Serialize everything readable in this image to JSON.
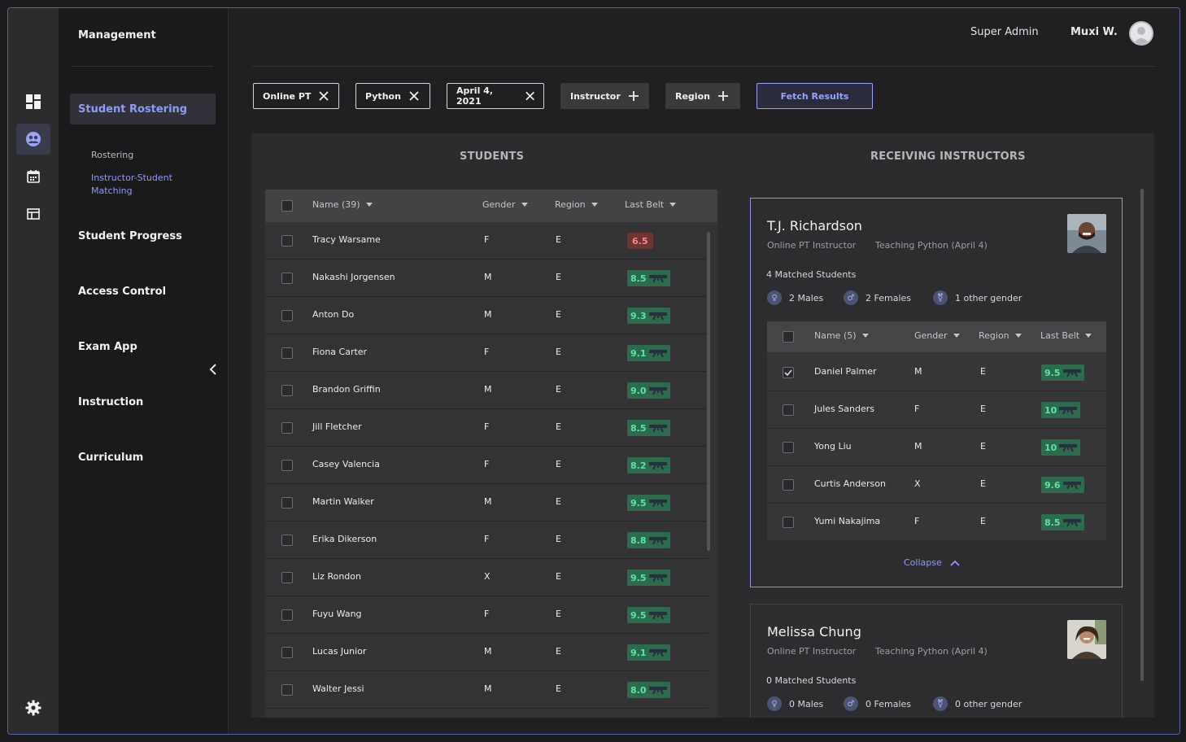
{
  "nav": {
    "title": "Management",
    "active_section": "Student Rostering",
    "sub_items": [
      "Rostering",
      "Instructor-Student Matching"
    ],
    "items": [
      "Student Progress",
      "Access Control",
      "Exam App",
      "Instruction",
      "Curriculum"
    ]
  },
  "header": {
    "role": "Super Admin",
    "user": "Muxi W."
  },
  "filters": {
    "chips": [
      "Online PT",
      "Python",
      "April 4, 2021"
    ],
    "add_chips": [
      "Instructor",
      "Region"
    ],
    "fetch_label": "Fetch Results"
  },
  "students": {
    "heading": "STUDENTS",
    "columns": [
      "Name (39)",
      "Gender",
      "Region",
      "Last Belt"
    ],
    "rows": [
      {
        "name": "Tracy Warsame",
        "gender": "F",
        "region": "E",
        "belt": "6.5",
        "status": "red"
      },
      {
        "name": "Nakashi Jorgensen",
        "gender": "M",
        "region": "E",
        "belt": "8.5",
        "status": "green"
      },
      {
        "name": "Anton Do",
        "gender": "M",
        "region": "E",
        "belt": "9.3",
        "status": "green"
      },
      {
        "name": "Fiona Carter",
        "gender": "F",
        "region": "E",
        "belt": "9.1",
        "status": "green"
      },
      {
        "name": "Brandon Griffin",
        "gender": "M",
        "region": "E",
        "belt": "9.0",
        "status": "green"
      },
      {
        "name": "Jill Fletcher",
        "gender": "F",
        "region": "E",
        "belt": "8.5",
        "status": "green"
      },
      {
        "name": "Casey Valencia",
        "gender": "F",
        "region": "E",
        "belt": "8.2",
        "status": "green"
      },
      {
        "name": "Martin Walker",
        "gender": "M",
        "region": "E",
        "belt": "9.5",
        "status": "green"
      },
      {
        "name": "Erika Dikerson",
        "gender": "F",
        "region": "E",
        "belt": "8.8",
        "status": "green"
      },
      {
        "name": "Liz Rondon",
        "gender": "X",
        "region": "E",
        "belt": "9.5",
        "status": "green"
      },
      {
        "name": "Fuyu Wang",
        "gender": "F",
        "region": "E",
        "belt": "9.5",
        "status": "green"
      },
      {
        "name": "Lucas Junior",
        "gender": "M",
        "region": "E",
        "belt": "9.1",
        "status": "green"
      },
      {
        "name": "Walter Jessi",
        "gender": "M",
        "region": "E",
        "belt": "8.0",
        "status": "green"
      }
    ]
  },
  "instructors": {
    "heading": "RECEIVING INSTRUCTORS",
    "cards": [
      {
        "name": "T.J. Richardson",
        "role": "Online PT Instructor",
        "teaching": "Teaching Python (April 4)",
        "matched": "4 Matched Students",
        "males": "2 Males",
        "females": "2 Females",
        "other": "1 other gender",
        "columns": [
          "Name (5)",
          "Gender",
          "Region",
          "Last Belt"
        ],
        "rows": [
          {
            "name": "Daniel Palmer",
            "gender": "M",
            "region": "E",
            "belt": "9.5",
            "checked": true
          },
          {
            "name": "Jules Sanders",
            "gender": "F",
            "region": "E",
            "belt": "10",
            "checked": false
          },
          {
            "name": "Yong Liu",
            "gender": "M",
            "region": "E",
            "belt": "10",
            "checked": false
          },
          {
            "name": "Curtis Anderson",
            "gender": "X",
            "region": "E",
            "belt": "9.6",
            "checked": false
          },
          {
            "name": "Yumi Nakajima",
            "gender": "F",
            "region": "E",
            "belt": "8.5",
            "checked": false
          }
        ],
        "collapse_label": "Collapse"
      },
      {
        "name": "Melissa Chung",
        "role": "Online PT Instructor",
        "teaching": "Teaching Python (April 4)",
        "matched": "0 Matched Students",
        "males": "0 Males",
        "females": "0 Females",
        "other": "0 other gender"
      }
    ]
  },
  "colors": {
    "accent": "#8f9cf5",
    "belt_green": "#2d6b4f",
    "belt_red": "#6e3535",
    "frame_border": "#5b63a8"
  },
  "icons": [
    "dashboard-icon",
    "people-icon",
    "calendar-icon",
    "table-icon",
    "gear-icon",
    "close-icon",
    "plus-icon",
    "chevron-left-icon",
    "chevron-up-icon",
    "caret-down-icon",
    "avatar-icon",
    "belt-icon",
    "male-icon",
    "female-icon",
    "other-gender-icon"
  ]
}
